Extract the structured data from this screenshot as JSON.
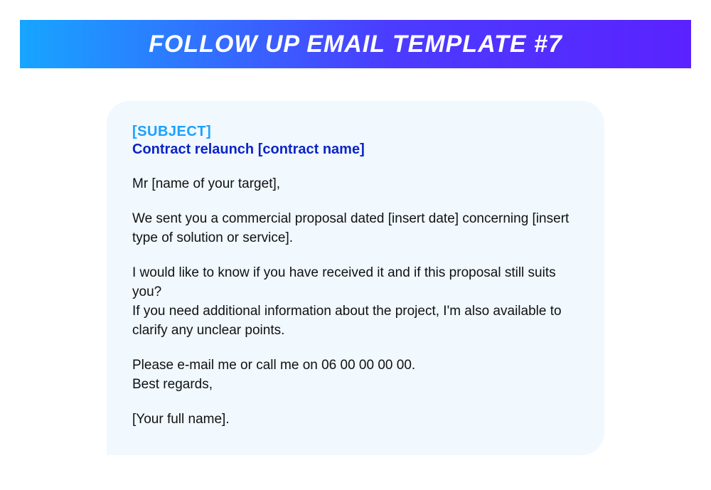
{
  "header": {
    "title": "FOLLOW UP EMAIL TEMPLATE #7"
  },
  "card": {
    "subject_label": "[SUBJECT]",
    "subject_line": "Contract relaunch [contract name]",
    "salutation": "Mr [name of your target],",
    "para1": "We sent you a commercial proposal dated [insert date] concerning [insert type of solution or service].",
    "para2a": "I would like to know if you have received it and if this proposal still suits you?",
    "para2b": "If you need additional information about the project, I'm also available to clarify any unclear points.",
    "para3a": "Please e-mail me or call me on 06 00 00 00 00.",
    "para3b": "Best regards,",
    "signoff": "[Your full name]."
  }
}
